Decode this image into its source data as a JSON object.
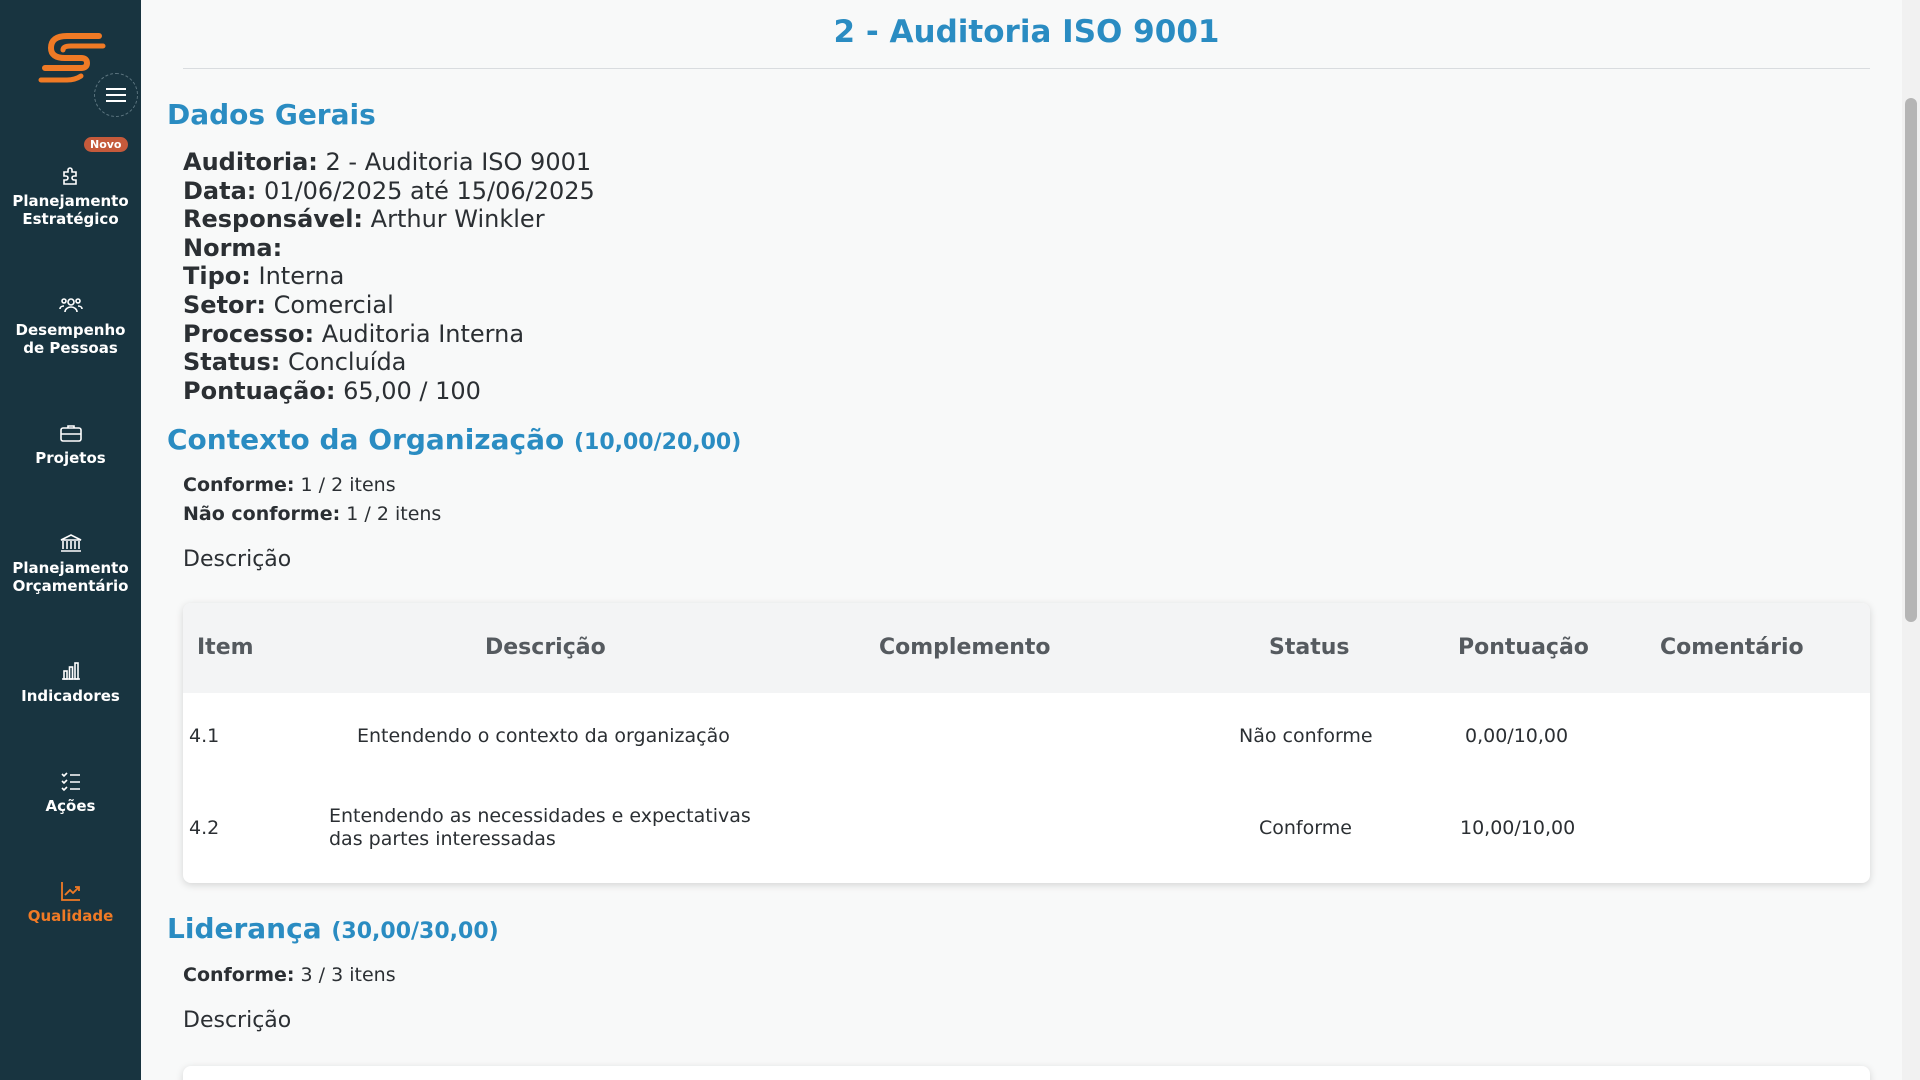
{
  "sidebar": {
    "badge": "Novo",
    "items": [
      {
        "label_1": "Planejamento",
        "label_2": "Estratégico",
        "icon": "puzzle-icon"
      },
      {
        "label_1": "Desempenho",
        "label_2": "de Pessoas",
        "icon": "people-icon"
      },
      {
        "label_1": "Projetos",
        "label_2": "",
        "icon": "briefcase-icon"
      },
      {
        "label_1": "Planejamento",
        "label_2": "Orçamentário",
        "icon": "bank-icon"
      },
      {
        "label_1": "Indicadores",
        "label_2": "",
        "icon": "bar-chart-icon"
      },
      {
        "label_1": "Ações",
        "label_2": "",
        "icon": "checklist-icon"
      },
      {
        "label_1": "Qualidade",
        "label_2": "",
        "icon": "trend-chart-icon"
      }
    ],
    "colors": {
      "bg": "#183440",
      "active": "#f07a25"
    }
  },
  "page": {
    "title": "2 - Auditoria ISO 9001"
  },
  "general": {
    "heading": "Dados Gerais",
    "fields": [
      {
        "label": "Auditoria:",
        "value": "2 - Auditoria ISO 9001"
      },
      {
        "label": "Data:",
        "value": "01/06/2025 até 15/06/2025"
      },
      {
        "label": "Responsável:",
        "value": "Arthur Winkler"
      },
      {
        "label": "Norma:",
        "value": ""
      },
      {
        "label": "Tipo:",
        "value": "Interna"
      },
      {
        "label": "Setor:",
        "value": "Comercial"
      },
      {
        "label": "Processo:",
        "value": "Auditoria Interna"
      },
      {
        "label": "Status:",
        "value": "Concluída"
      },
      {
        "label": "Pontuação:",
        "value": "65,00 / 100"
      }
    ]
  },
  "section1": {
    "title": "Contexto da Organização",
    "score": "(10,00/20,00)",
    "conforme_label": "Conforme:",
    "conforme_value": "1 / 2 itens",
    "nao_conforme_label": "Não conforme:",
    "nao_conforme_value": "1 / 2 itens",
    "desc_label": "Descrição",
    "table": {
      "headers": {
        "item": "Item",
        "descricao": "Descrição",
        "complemento": "Complemento",
        "status": "Status",
        "pontuacao": "Pontuação",
        "comentario": "Comentário"
      },
      "rows": [
        {
          "item": "4.1",
          "descricao_1": "Entendendo o contexto da organização",
          "descricao_2": "",
          "status": "Não conforme",
          "pontuacao": "0,00/10,00"
        },
        {
          "item": "4.2",
          "descricao_1": "Entendendo as necessidades e expectativas",
          "descricao_2": "das partes interessadas",
          "status": "Conforme",
          "pontuacao": "10,00/10,00"
        }
      ]
    }
  },
  "section2": {
    "title": "Liderança",
    "score": "(30,00/30,00)",
    "conforme_label": "Conforme:",
    "conforme_value": "3 / 3 itens",
    "desc_label": "Descrição"
  }
}
